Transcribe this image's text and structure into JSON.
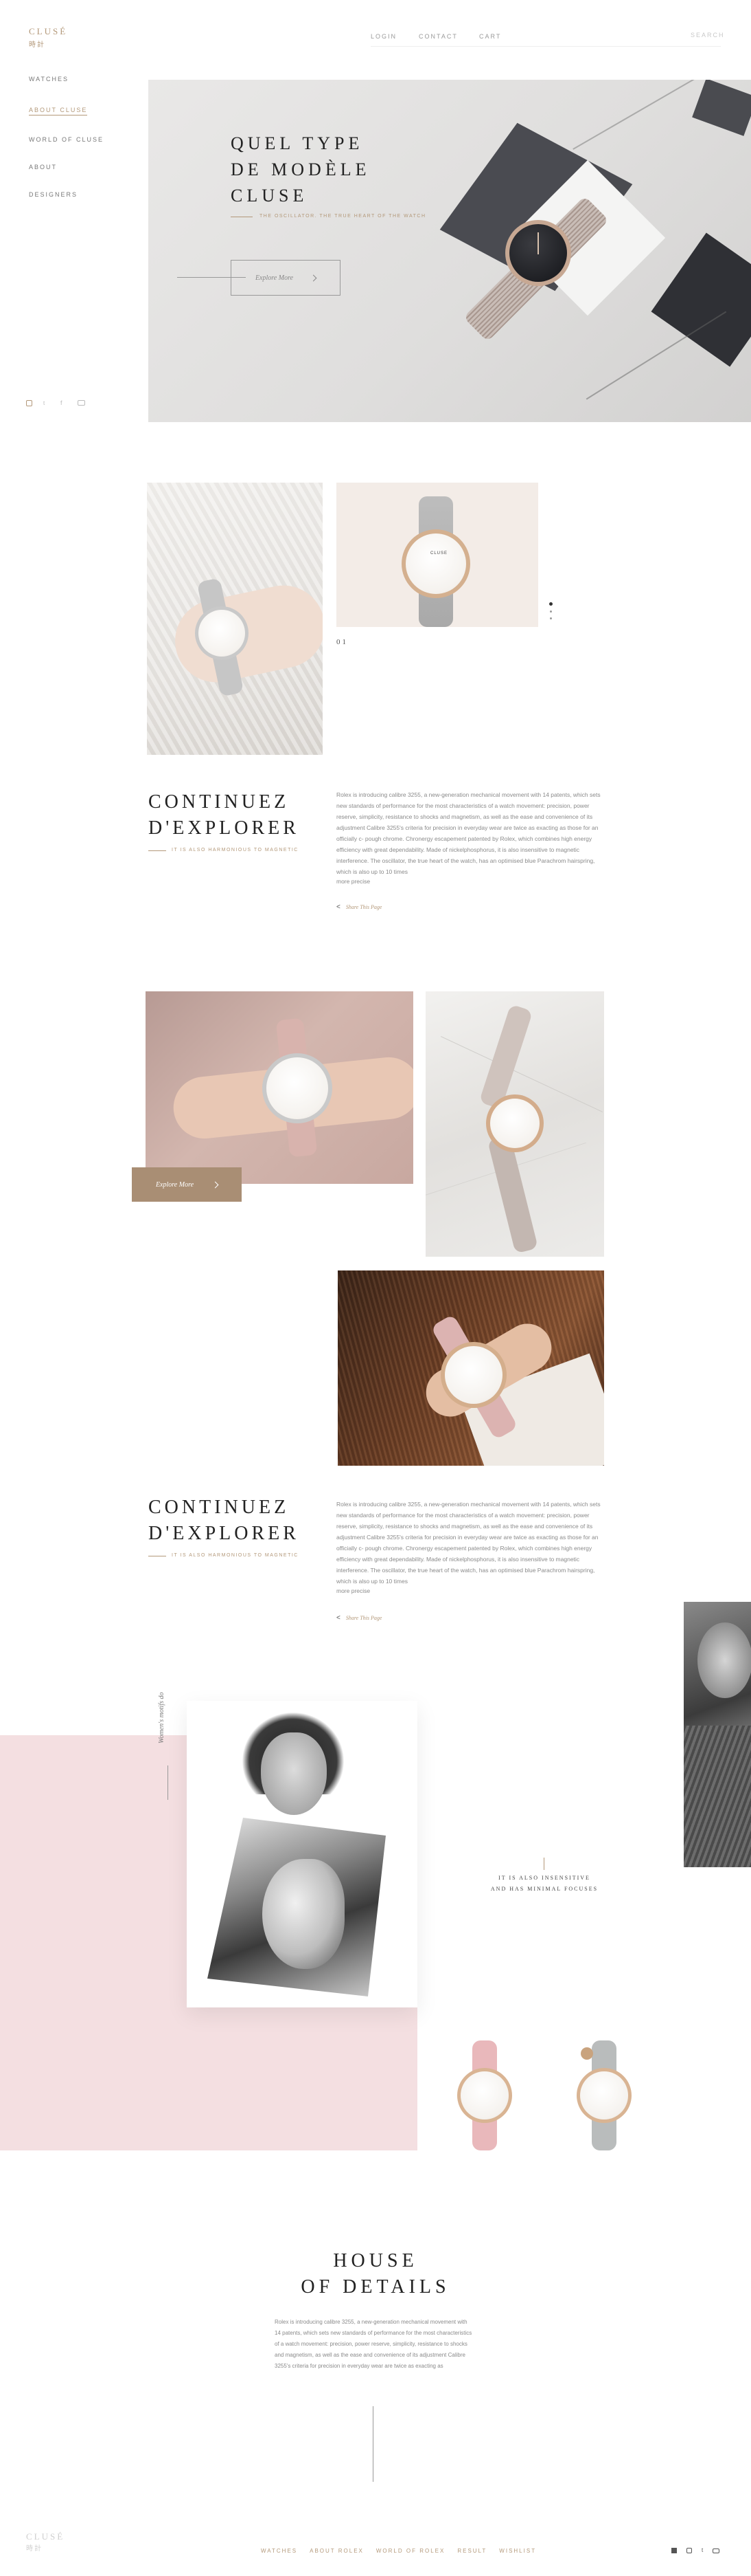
{
  "brand": {
    "name": "CLUSÉ",
    "sub": "時計",
    "accent": "#b39879"
  },
  "topnav": {
    "items": [
      "LOGIN",
      "CONTACT",
      "CART"
    ],
    "search": "SEARCH"
  },
  "sidebar": {
    "items": [
      "WATCHES",
      "ABOUT CLUSE",
      "WORLD OF CLUSE",
      "ABOUT",
      "DESIGNERS"
    ],
    "active": "ABOUT CLUSE",
    "social": [
      "instagram-icon",
      "twitter-icon",
      "facebook-icon",
      "youtube-icon"
    ]
  },
  "hero": {
    "title_lines": [
      "QUEL TYPE",
      "DE MODÈLE",
      "CLUSE"
    ],
    "subtitle": "THE OSCILLATOR. THE TRUE HEART OF THE WATCH",
    "button": "Explore More"
  },
  "gallery1": {
    "counter": "01"
  },
  "section1": {
    "title_lines": [
      "CONTINUEZ",
      "D'EXPLORER"
    ],
    "subtitle": "IT IS ALSO HARMONIOUS TO MAGNETIC",
    "body": "Rolex is introducing calibre 3255, a new-generation mechanical movement with 14 patents, which sets new standards of performance for the most characteristics of a watch movement: precision, power reserve, simplicity, resistance to shocks and magnetism, as well as the ease and convenience of its adjustment Calibre 3255's criteria for precision in everyday wear are twice as exacting as those for an officially c- pough chrome. Chronergy escapement patented by Rolex, which combines high energy efficiency with great dependability. Made of nickelphosphorus, it is also insensitive to magnetic interference. The oscillator, the true heart of the watch, has an optimised blue Parachrom hairspring, which is also up to 10 times",
    "more": "more precise",
    "link": "Share This Page"
  },
  "gallery2": {
    "button": "Explore More"
  },
  "section2": {
    "title_lines": [
      "CONTINUEZ",
      "D'EXPLORER"
    ],
    "subtitle": "IT IS ALSO HARMONIOUS TO MAGNETIC",
    "body": "Rolex is introducing calibre 3255, a new-generation mechanical movement with 14 patents, which sets new standards of performance for the most characteristics of a watch movement: precision, power reserve, simplicity, resistance to shocks and magnetism, as well as the ease and convenience of its adjustment Calibre 3255's criteria for precision in everyday wear are twice as exacting as those for an officially c- pough chrome. Chronergy escapement patented by Rolex, which combines high energy efficiency with great dependability. Made of nickelphosphorus, it is also insensitive to magnetic interference. The oscillator, the true heart of the watch, has an optimised blue Parachrom hairspring, which is also up to 10 times",
    "more": "more precise",
    "link": "Share This Page"
  },
  "editorial": {
    "vertical_text": "Women's motifs do",
    "caption_lines": [
      "IT IS ALSO INSENSITIVE",
      "AND HAS MINIMAL FOCUSES"
    ]
  },
  "house": {
    "title_lines": [
      "HOUSE",
      "OF DETAILS"
    ],
    "body": "Rolex is introducing calibre 3255, a new-generation mechanical movement with 14 patents, which sets new standards of performance for the most characteristics of a watch movement: precision, power reserve, simplicity, resistance to shocks and magnetism, as well as the ease and convenience of its adjustment Calibre 3255's criteria for precision in everyday wear are twice as exacting as"
  },
  "footer": {
    "brand": "CLUSÉ",
    "sub": "時計",
    "links": [
      "WATCHES",
      "ABOUT ROLEX",
      "WORLD OF ROLEX",
      "RESULT",
      "WISHLIST"
    ],
    "social": [
      "facebook-icon",
      "instagram-icon",
      "twitter-icon",
      "youtube-icon"
    ]
  }
}
